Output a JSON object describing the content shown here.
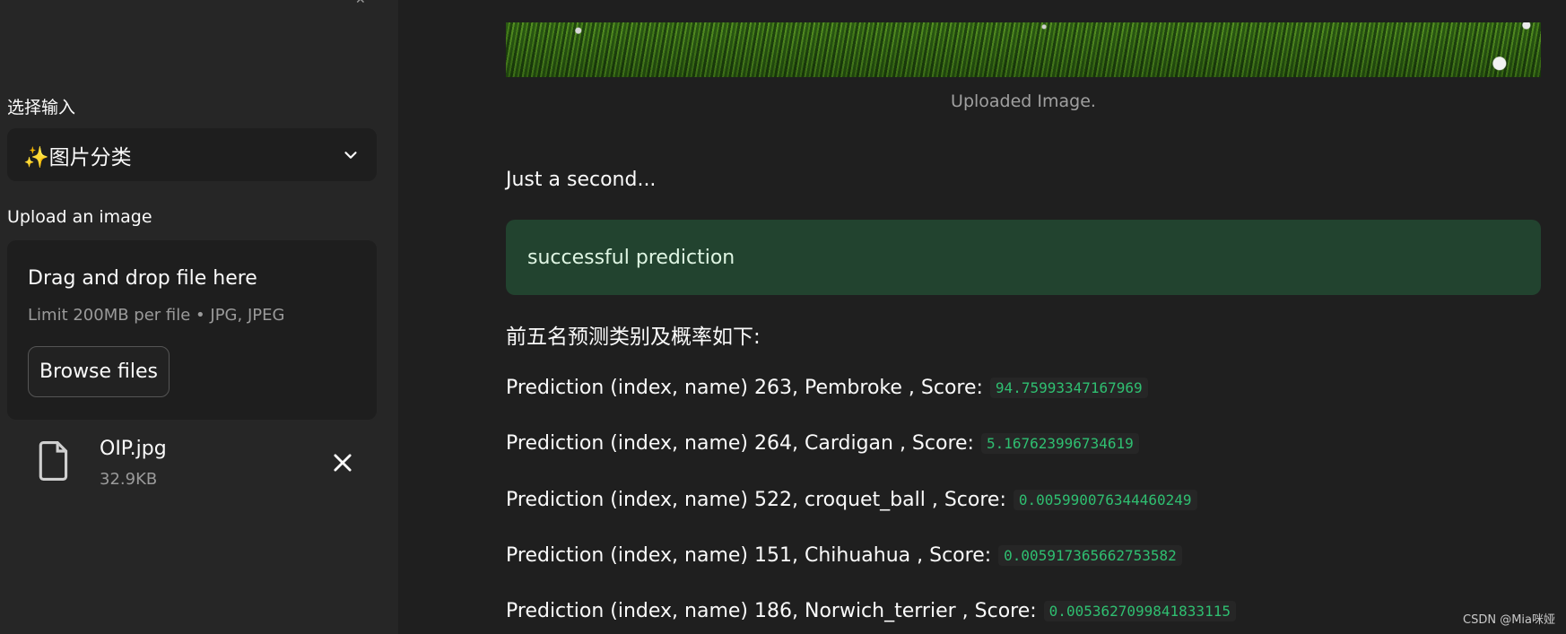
{
  "sidebar": {
    "input_label": "选择输入",
    "select_value": "✨图片分类",
    "upload_label": "Upload an image",
    "uploader": {
      "title": "Drag and drop file here",
      "limit": "Limit 200MB per file • JPG, JPEG",
      "browse_button": "Browse files"
    },
    "file": {
      "name": "OIP.jpg",
      "size": "32.9KB"
    }
  },
  "main": {
    "image_caption": "Uploaded Image.",
    "wait_text": "Just a second...",
    "success_message": "successful prediction",
    "top5_heading": "前五名预测类别及概率如下:",
    "predictions": [
      {
        "text": "Prediction (index, name) 263, Pembroke , Score:",
        "score": "94.75993347167969"
      },
      {
        "text": "Prediction (index, name) 264, Cardigan , Score:",
        "score": "5.167623996734619"
      },
      {
        "text": "Prediction (index, name) 522, croquet_ball , Score:",
        "score": "0.005990076344460249"
      },
      {
        "text": "Prediction (index, name) 151, Chihuahua , Score:",
        "score": "0.005917365662753582"
      },
      {
        "text": "Prediction (index, name) 186, Norwich_terrier , Score:",
        "score": "0.0053627099841833115"
      }
    ]
  },
  "watermark": "CSDN @Mia咪娅",
  "colors": {
    "background": "#1f1f1f",
    "sidebar": "#262626",
    "success_bg": "#22432f",
    "score_text": "#2fbf71"
  },
  "icons": {
    "select_chevron": "chevron-down-icon",
    "file": "file-icon",
    "remove": "close-icon"
  }
}
